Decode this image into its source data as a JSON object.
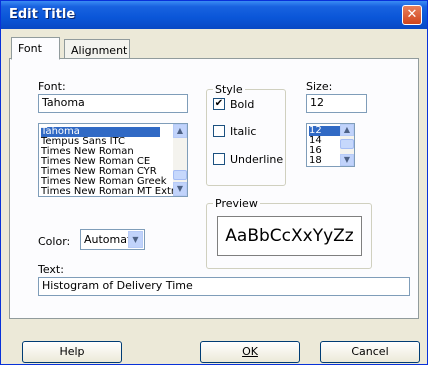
{
  "window": {
    "title": "Edit Title"
  },
  "tabs": [
    {
      "label": "Font"
    },
    {
      "label": "Alignment"
    }
  ],
  "font": {
    "label": "Font:",
    "value": "Tahoma",
    "list": [
      "Tahoma",
      "Tempus Sans ITC",
      "Times New Roman",
      "Times New Roman CE",
      "Times New Roman CYR",
      "Times New Roman Greek",
      "Times New Roman MT Extra"
    ]
  },
  "style": {
    "title": "Style",
    "bold": {
      "label": "Bold",
      "checked": true
    },
    "italic": {
      "label": "Italic",
      "checked": false
    },
    "underline": {
      "label": "Underline",
      "checked": false
    }
  },
  "size": {
    "label": "Size:",
    "value": "12",
    "list": [
      "12",
      "14",
      "16",
      "18"
    ]
  },
  "color": {
    "label": "Color:",
    "value": "Automatic"
  },
  "preview": {
    "title": "Preview",
    "sample": "AaBbCcXxYyZz"
  },
  "text": {
    "label": "Text:",
    "value": "Histogram of Delivery Time"
  },
  "buttons": {
    "help": "Help",
    "ok": "OK",
    "cancel": "Cancel"
  }
}
